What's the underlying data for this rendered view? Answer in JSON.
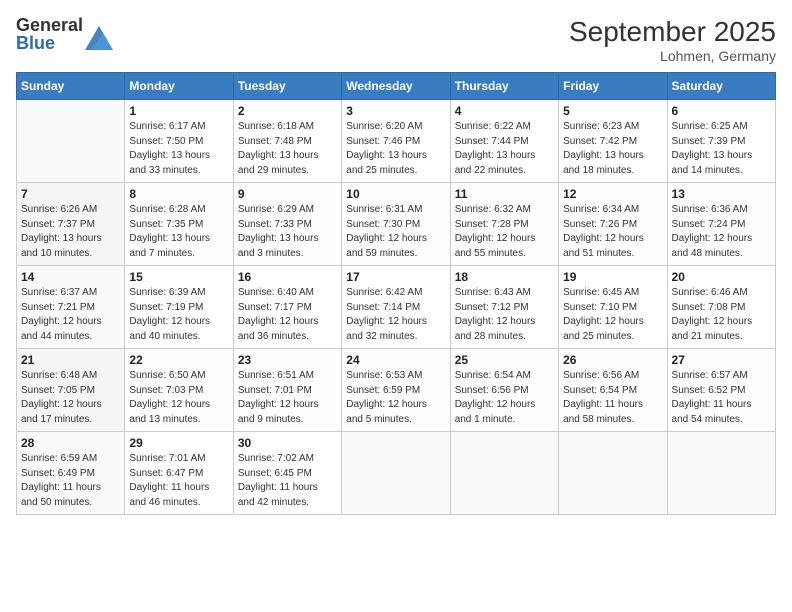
{
  "header": {
    "logo_general": "General",
    "logo_blue": "Blue",
    "month_title": "September 2025",
    "location": "Lohmen, Germany"
  },
  "days_of_week": [
    "Sunday",
    "Monday",
    "Tuesday",
    "Wednesday",
    "Thursday",
    "Friday",
    "Saturday"
  ],
  "weeks": [
    [
      {
        "day": "",
        "info": ""
      },
      {
        "day": "1",
        "info": "Sunrise: 6:17 AM\nSunset: 7:50 PM\nDaylight: 13 hours\nand 33 minutes."
      },
      {
        "day": "2",
        "info": "Sunrise: 6:18 AM\nSunset: 7:48 PM\nDaylight: 13 hours\nand 29 minutes."
      },
      {
        "day": "3",
        "info": "Sunrise: 6:20 AM\nSunset: 7:46 PM\nDaylight: 13 hours\nand 25 minutes."
      },
      {
        "day": "4",
        "info": "Sunrise: 6:22 AM\nSunset: 7:44 PM\nDaylight: 13 hours\nand 22 minutes."
      },
      {
        "day": "5",
        "info": "Sunrise: 6:23 AM\nSunset: 7:42 PM\nDaylight: 13 hours\nand 18 minutes."
      },
      {
        "day": "6",
        "info": "Sunrise: 6:25 AM\nSunset: 7:39 PM\nDaylight: 13 hours\nand 14 minutes."
      }
    ],
    [
      {
        "day": "7",
        "info": "Sunrise: 6:26 AM\nSunset: 7:37 PM\nDaylight: 13 hours\nand 10 minutes."
      },
      {
        "day": "8",
        "info": "Sunrise: 6:28 AM\nSunset: 7:35 PM\nDaylight: 13 hours\nand 7 minutes."
      },
      {
        "day": "9",
        "info": "Sunrise: 6:29 AM\nSunset: 7:33 PM\nDaylight: 13 hours\nand 3 minutes."
      },
      {
        "day": "10",
        "info": "Sunrise: 6:31 AM\nSunset: 7:30 PM\nDaylight: 12 hours\nand 59 minutes."
      },
      {
        "day": "11",
        "info": "Sunrise: 6:32 AM\nSunset: 7:28 PM\nDaylight: 12 hours\nand 55 minutes."
      },
      {
        "day": "12",
        "info": "Sunrise: 6:34 AM\nSunset: 7:26 PM\nDaylight: 12 hours\nand 51 minutes."
      },
      {
        "day": "13",
        "info": "Sunrise: 6:36 AM\nSunset: 7:24 PM\nDaylight: 12 hours\nand 48 minutes."
      }
    ],
    [
      {
        "day": "14",
        "info": "Sunrise: 6:37 AM\nSunset: 7:21 PM\nDaylight: 12 hours\nand 44 minutes."
      },
      {
        "day": "15",
        "info": "Sunrise: 6:39 AM\nSunset: 7:19 PM\nDaylight: 12 hours\nand 40 minutes."
      },
      {
        "day": "16",
        "info": "Sunrise: 6:40 AM\nSunset: 7:17 PM\nDaylight: 12 hours\nand 36 minutes."
      },
      {
        "day": "17",
        "info": "Sunrise: 6:42 AM\nSunset: 7:14 PM\nDaylight: 12 hours\nand 32 minutes."
      },
      {
        "day": "18",
        "info": "Sunrise: 6:43 AM\nSunset: 7:12 PM\nDaylight: 12 hours\nand 28 minutes."
      },
      {
        "day": "19",
        "info": "Sunrise: 6:45 AM\nSunset: 7:10 PM\nDaylight: 12 hours\nand 25 minutes."
      },
      {
        "day": "20",
        "info": "Sunrise: 6:46 AM\nSunset: 7:08 PM\nDaylight: 12 hours\nand 21 minutes."
      }
    ],
    [
      {
        "day": "21",
        "info": "Sunrise: 6:48 AM\nSunset: 7:05 PM\nDaylight: 12 hours\nand 17 minutes."
      },
      {
        "day": "22",
        "info": "Sunrise: 6:50 AM\nSunset: 7:03 PM\nDaylight: 12 hours\nand 13 minutes."
      },
      {
        "day": "23",
        "info": "Sunrise: 6:51 AM\nSunset: 7:01 PM\nDaylight: 12 hours\nand 9 minutes."
      },
      {
        "day": "24",
        "info": "Sunrise: 6:53 AM\nSunset: 6:59 PM\nDaylight: 12 hours\nand 5 minutes."
      },
      {
        "day": "25",
        "info": "Sunrise: 6:54 AM\nSunset: 6:56 PM\nDaylight: 12 hours\nand 1 minute."
      },
      {
        "day": "26",
        "info": "Sunrise: 6:56 AM\nSunset: 6:54 PM\nDaylight: 11 hours\nand 58 minutes."
      },
      {
        "day": "27",
        "info": "Sunrise: 6:57 AM\nSunset: 6:52 PM\nDaylight: 11 hours\nand 54 minutes."
      }
    ],
    [
      {
        "day": "28",
        "info": "Sunrise: 6:59 AM\nSunset: 6:49 PM\nDaylight: 11 hours\nand 50 minutes."
      },
      {
        "day": "29",
        "info": "Sunrise: 7:01 AM\nSunset: 6:47 PM\nDaylight: 11 hours\nand 46 minutes."
      },
      {
        "day": "30",
        "info": "Sunrise: 7:02 AM\nSunset: 6:45 PM\nDaylight: 11 hours\nand 42 minutes."
      },
      {
        "day": "",
        "info": ""
      },
      {
        "day": "",
        "info": ""
      },
      {
        "day": "",
        "info": ""
      },
      {
        "day": "",
        "info": ""
      }
    ]
  ]
}
